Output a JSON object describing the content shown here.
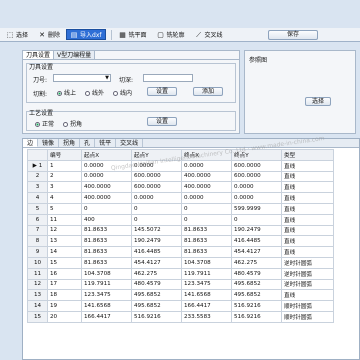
{
  "toolbar": {
    "select": "选择",
    "delete": "删除",
    "import_dxf": "导入dxf",
    "face_mill": "铣平面",
    "contour_mill": "铣轮廓",
    "cross_line": "交叉线",
    "save": "保存"
  },
  "panel": {
    "tabs": [
      "刀具设置",
      "V型刀编程量"
    ],
    "tool_group_title": "刀具设置",
    "tool_label": "刀号:",
    "cut_depth_label": "切深:",
    "cut_mode_label": "切割:",
    "radio_on_line": "线上",
    "radio_outside": "线外",
    "radio_inside": "线内",
    "set_button": "设置",
    "add_button": "添加",
    "process_group_title": "工艺设置",
    "radio_normal": "正常",
    "radio_corner": "拐角",
    "process_set_button": "设置"
  },
  "reference": {
    "title": "参照图",
    "select_button": "选择"
  },
  "bottom": {
    "tabs": [
      "边",
      "镜像",
      "拐角",
      "孔",
      "铣平",
      "交叉线"
    ],
    "columns": [
      "",
      "编号",
      "起点X",
      "起点Y",
      "终点X",
      "终点Y",
      "类型"
    ],
    "rows": [
      [
        "▶ 1",
        "1",
        "0.0000",
        "0.0000",
        "0.0000",
        "600.0000",
        "直线"
      ],
      [
        "2",
        "2",
        "0.0000",
        "600.0000",
        "400.0000",
        "600.0000",
        "直线"
      ],
      [
        "3",
        "3",
        "400.0000",
        "600.0000",
        "400.0000",
        "0.0000",
        "直线"
      ],
      [
        "4",
        "4",
        "400.0000",
        "0.0000",
        "0.0000",
        "0.0000",
        "直线"
      ],
      [
        "5",
        "5",
        "0",
        "0",
        "0",
        "599.9999",
        "直线"
      ],
      [
        "6",
        "11",
        "400",
        "0",
        "0",
        "0",
        "直线"
      ],
      [
        "7",
        "12",
        "81.8633",
        "145.5072",
        "81.8633",
        "190.2479",
        "直线"
      ],
      [
        "8",
        "13",
        "81.8633",
        "190.2479",
        "81.8633",
        "416.4485",
        "直线"
      ],
      [
        "9",
        "14",
        "81.8633",
        "416.4485",
        "81.8633",
        "454.4127",
        "直线"
      ],
      [
        "10",
        "15",
        "81.8633",
        "454.4127",
        "104.3708",
        "462.275",
        "逆时针圆弧"
      ],
      [
        "11",
        "16",
        "104.3708",
        "462.275",
        "119.7911",
        "480.4579",
        "逆时针圆弧"
      ],
      [
        "12",
        "17",
        "119.7911",
        "480.4579",
        "123.3475",
        "495.6852",
        "逆时针圆弧"
      ],
      [
        "13",
        "18",
        "123.3475",
        "495.6852",
        "141.6568",
        "495.6852",
        "直线"
      ],
      [
        "14",
        "19",
        "141.6568",
        "495.6852",
        "166.4417",
        "516.9216",
        "顺时针圆弧"
      ],
      [
        "15",
        "20",
        "166.4417",
        "516.9216",
        "233.5583",
        "516.9216",
        "顺时针圆弧"
      ]
    ]
  },
  "watermark": "Qingdao Hailian Intelligent Machinery Co.,Ltd · www.made-in-china.com"
}
